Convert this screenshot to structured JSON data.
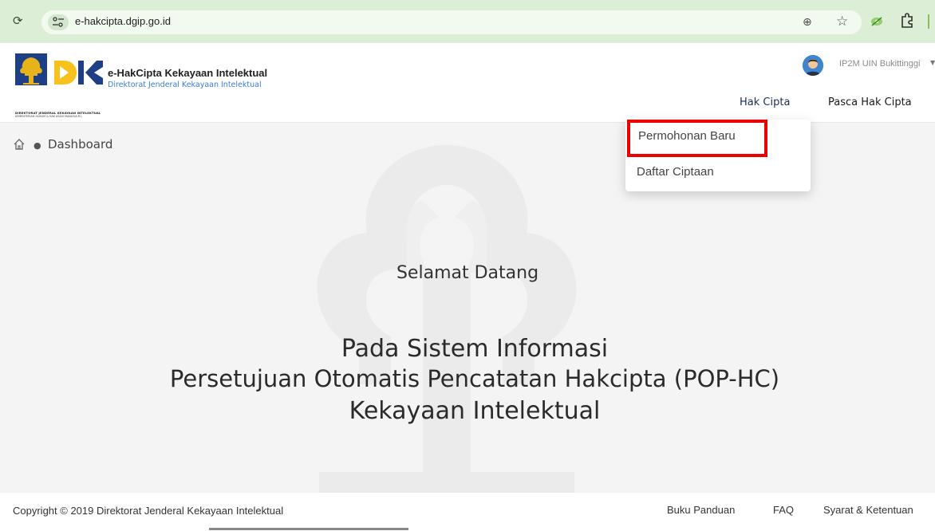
{
  "browser": {
    "url": "e-hakcipta.dgip.go.id",
    "icons": [
      "reload-icon",
      "site-info-icon",
      "zoom-icon",
      "bookmark-star-icon",
      "eye-extension-icon",
      "extensions-puzzle-icon"
    ]
  },
  "header": {
    "logo_small_line1": "DIREKTORAT JENDERAL KEKAYAAN INTELEKTUAL",
    "logo_small_line2": "KEMENTERIAN HUKUM & HAK ASASI MANUSIA R.I.",
    "brand_title": "e-HakCipta Kekayaan Intelektual",
    "brand_subtitle": "Direktorat Jenderal Kekayaan Intelektual",
    "user_name": "IP2M UIN Bukittinggi",
    "nav": {
      "hak_cipta": "Hak Cipta",
      "pasca_hak_cipta": "Pasca Hak Cipta"
    }
  },
  "dropdown": {
    "items": [
      {
        "label": "Permohonan Baru",
        "highlighted": true
      },
      {
        "label": "Daftar Ciptaan",
        "highlighted": false
      }
    ],
    "highlight_color": "#ee0000"
  },
  "breadcrumb": {
    "current": "Dashboard"
  },
  "main": {
    "welcome": "Selamat Datang",
    "line1": "Pada Sistem Informasi",
    "line2": "Persetujuan Otomatis Pencatatan Hakcipta (POP-HC)",
    "line3": "Kekayaan Intelektual"
  },
  "footer": {
    "copyright": "Copyright © 2019 Direktorat Jenderal Kekayaan Intelektual",
    "links": {
      "buku_panduan": "Buku Panduan",
      "faq": "FAQ",
      "syarat": "Syarat & Ketentuan"
    }
  },
  "colors": {
    "chrome_bg": "#ddeed6",
    "accent_blue": "#3a7bd5",
    "nav_active": "#1e2b5a"
  }
}
